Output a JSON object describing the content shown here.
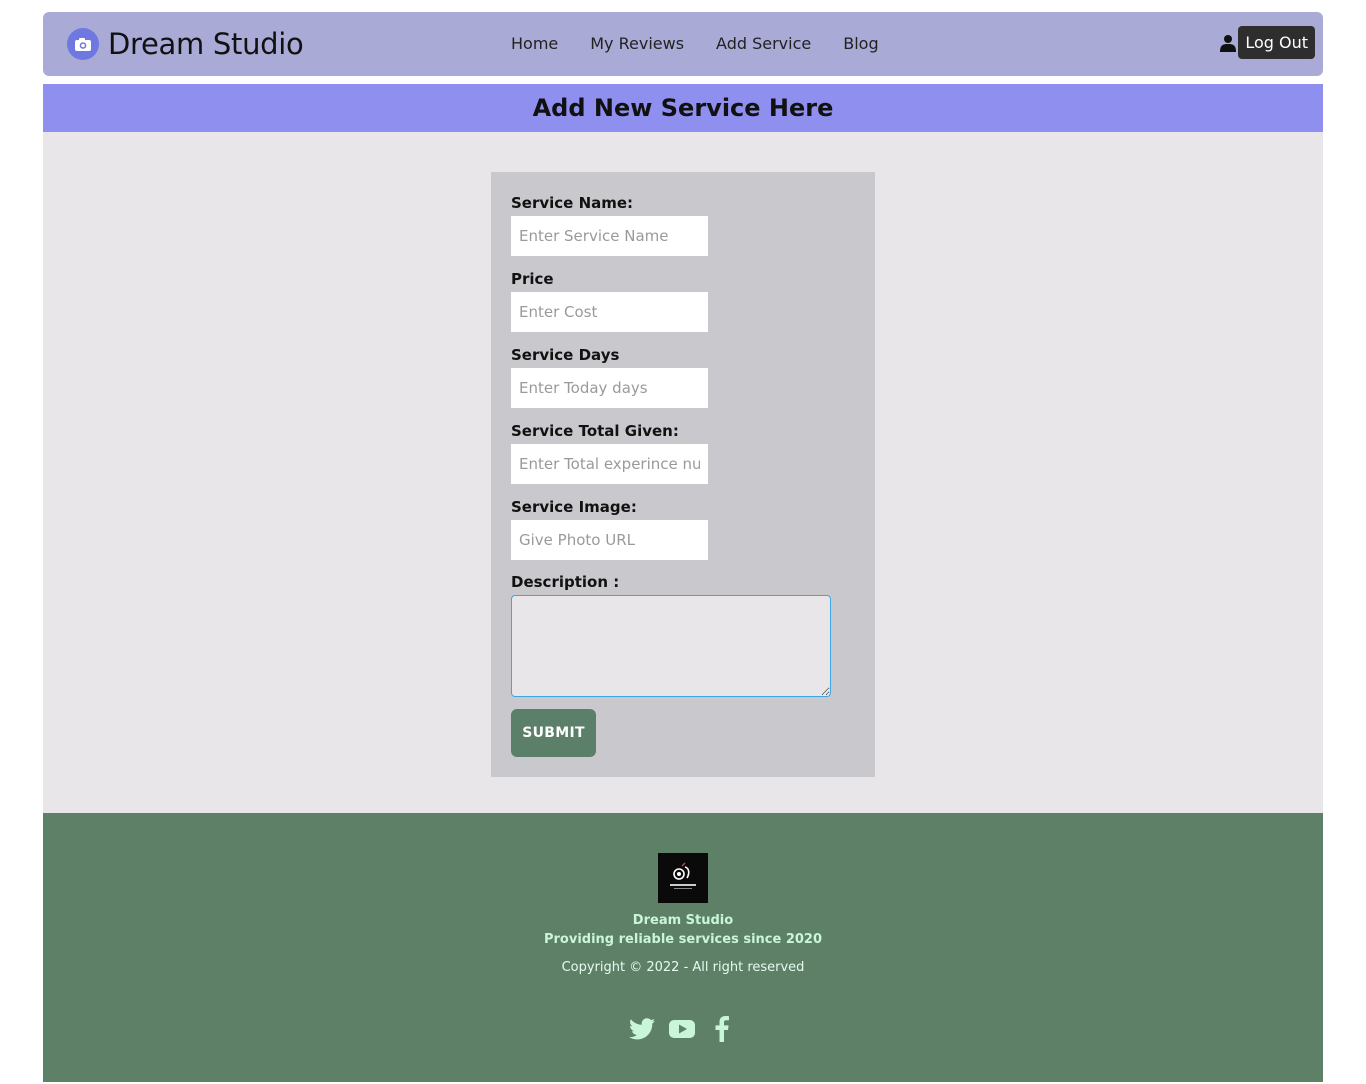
{
  "nav": {
    "brand": "Dream Studio",
    "links": [
      "Home",
      "My Reviews",
      "Add Service",
      "Blog"
    ],
    "logout_label": "Log Out"
  },
  "banner": {
    "title": "Add New Service Here"
  },
  "form": {
    "service_name": {
      "label": "Service Name:",
      "placeholder": "Enter Service Name"
    },
    "price": {
      "label": "Price",
      "placeholder": "Enter Cost"
    },
    "service_days": {
      "label": "Service Days",
      "placeholder": "Enter Today days"
    },
    "total_given": {
      "label": "Service Total Given:",
      "placeholder": "Enter Total experince number"
    },
    "image": {
      "label": "Service Image:",
      "placeholder": "Give Photo URL"
    },
    "description": {
      "label": "Description :"
    },
    "submit_label": "SUBMIT"
  },
  "footer": {
    "brand": "Dream Studio",
    "tagline": "Providing reliable services since 2020",
    "copyright": "Copyright © 2022 - All right reserved",
    "social_icons": [
      "twitter-icon",
      "youtube-icon",
      "facebook-icon"
    ]
  },
  "colors": {
    "navbar_bg": "#a9abd6",
    "banner_bg": "#8f8ff0",
    "main_bg": "#e8e6e8",
    "card_bg": "#c9c8cd",
    "accent_green": "#5b7f68",
    "footer_text": "#c9f5d9"
  }
}
